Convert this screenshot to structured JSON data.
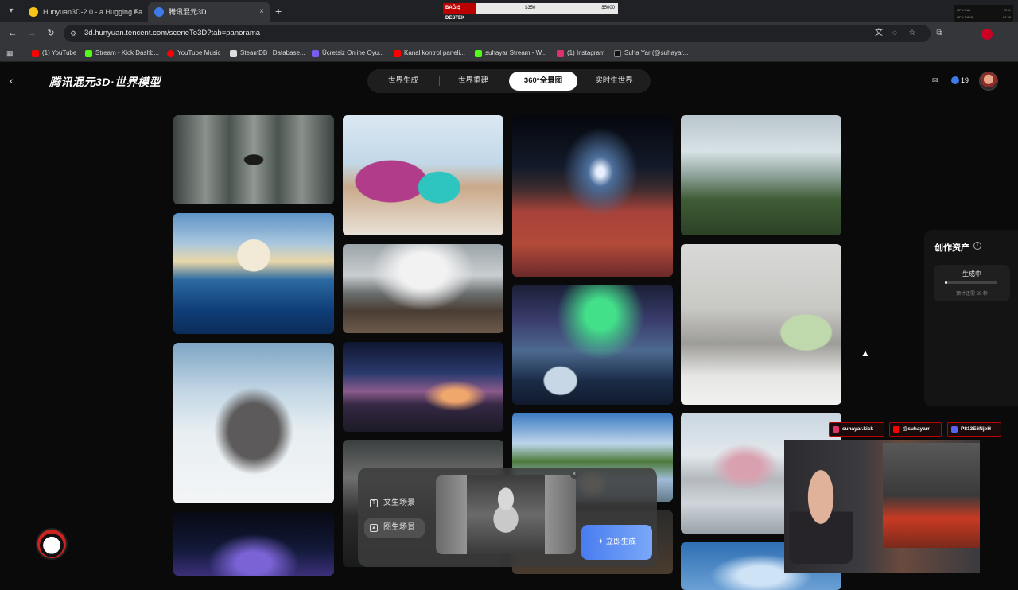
{
  "browser": {
    "tabs": [
      {
        "title": "Hunyuan3D-2.0 - a Hugging Fa",
        "favicon_color": "#f5c518"
      },
      {
        "title": "腾讯混元3D",
        "favicon_color": "#3d7bea"
      }
    ],
    "close_glyph": "×",
    "new_tab_glyph": "+",
    "url": "3d.hunyuan.tencent.com/sceneTo3D?tab=panorama",
    "bookmarks": [
      {
        "label": "(1) YouTube",
        "color": "#ff0000"
      },
      {
        "label": "Stream - Kick Dashb...",
        "color": "#53fc18"
      },
      {
        "label": "YouTube Music",
        "color": "#ff0000"
      },
      {
        "label": "SteamDB | Database...",
        "color": "#dddddd"
      },
      {
        "label": "Ücretsiz Online Oyu...",
        "color": "#7b5cf0"
      },
      {
        "label": "Kanal kontrol paneli...",
        "color": "#ff0000"
      },
      {
        "label": "suhayar Stream - W...",
        "color": "#53fc18"
      },
      {
        "label": "(1) Instagram",
        "color": "#e1306c"
      },
      {
        "label": "Suha Yar (@suhayar...",
        "color": "#111111"
      }
    ]
  },
  "stream_overlay": {
    "label": "BAĞIŞ DESTEK",
    "current": "$350",
    "goal": "$5000"
  },
  "hw_monitor": [
    {
      "label": "GPU KUL",
      "value": "29 %"
    },
    {
      "label": "GPU SICKL",
      "value": "51 °C"
    },
    {
      "label": "CPU KUL",
      "value": "16 %"
    },
    {
      "label": "CPU TEMP",
      "value": "57.5 °C"
    }
  ],
  "app": {
    "brand": "腾讯混元3D·世界模型",
    "tabs": [
      {
        "label": "世界生成",
        "active": false
      },
      {
        "label": "世界重建",
        "active": false
      },
      {
        "label": "360°全景图",
        "active": true
      },
      {
        "label": "实时生世界",
        "active": false
      }
    ],
    "credits": "19"
  },
  "panel": {
    "title": "创作资产",
    "job_status": "生成中",
    "job_progress": 0.05,
    "job_eta": "预计还需 39 秒"
  },
  "dock": {
    "modes": [
      {
        "label": "文生场景",
        "icon": "text-icon"
      },
      {
        "label": "图生场景",
        "icon": "image-icon"
      }
    ],
    "generate_label": "立即生成"
  },
  "social": [
    {
      "handle": "suhayar.kick",
      "color": "#e1306c"
    },
    {
      "handle": "@suhayarr",
      "color": "#ff0000"
    },
    {
      "handle": "P813E6NjeH",
      "color": "#5865f2"
    }
  ],
  "colors": {
    "accent": "#4a7cf0",
    "active_tab_bg": "#ffffff"
  }
}
